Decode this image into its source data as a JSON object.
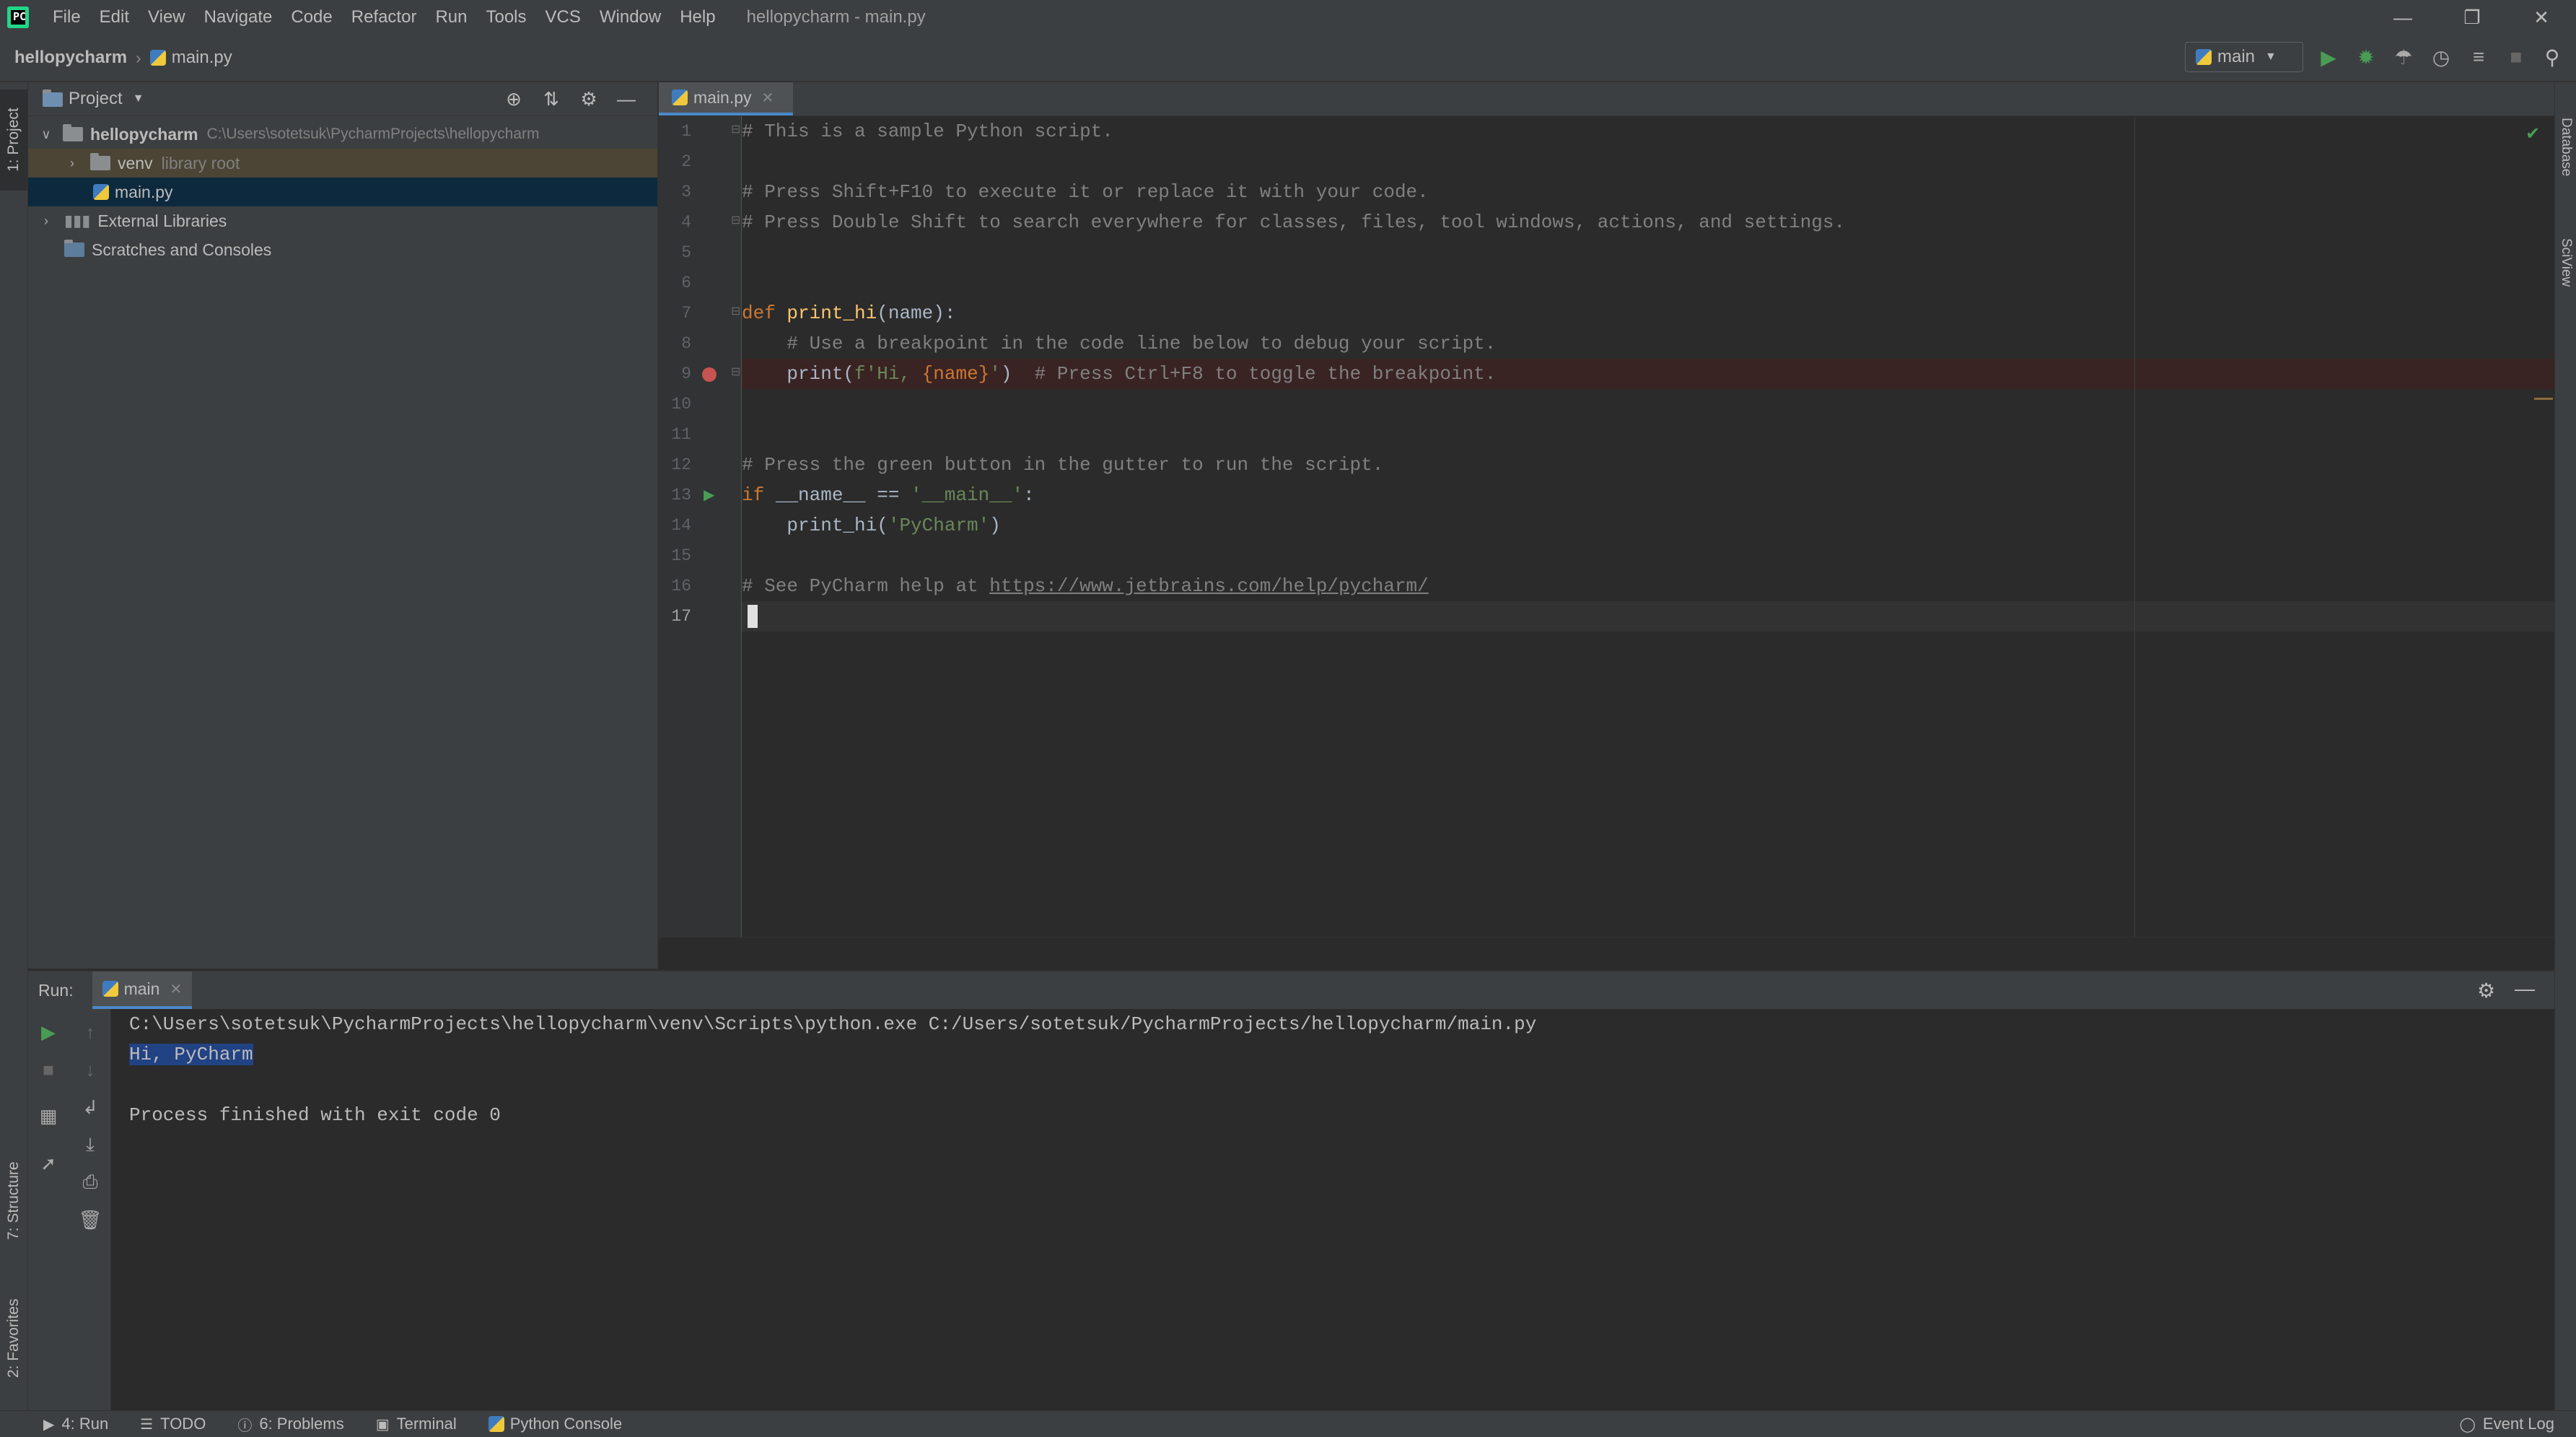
{
  "app": {
    "window_title": "hellopycharm - main.py",
    "menu": [
      "File",
      "Edit",
      "View",
      "Navigate",
      "Code",
      "Refactor",
      "Run",
      "Tools",
      "VCS",
      "Window",
      "Help"
    ]
  },
  "navbar": {
    "project": "hellopycharm",
    "file": "main.py",
    "run_config": "main"
  },
  "project_panel": {
    "title": "Project",
    "tree": [
      {
        "label": "hellopycharm",
        "hint": "C:\\Users\\sotetsuk\\PycharmProjects\\hellopycharm",
        "expanded": true
      },
      {
        "label": "venv",
        "hint": "library root",
        "expanded": false
      },
      {
        "label": "main.py",
        "hint": ""
      },
      {
        "label": "External Libraries",
        "hint": "",
        "expanded": false
      },
      {
        "label": "Scratches and Consoles",
        "hint": ""
      }
    ]
  },
  "editor": {
    "tab": "main.py",
    "line_numbers": [
      "1",
      "2",
      "3",
      "4",
      "5",
      "6",
      "7",
      "8",
      "9",
      "10",
      "11",
      "12",
      "13",
      "14",
      "15",
      "16",
      "17"
    ],
    "lines": {
      "l1": "# This is a sample Python script.",
      "l3": "# Press Shift+F10 to execute it or replace it with your code.",
      "l4": "# Press Double Shift to search everywhere for classes, files, tool windows, actions, and settings.",
      "l7_kw": "def ",
      "l7_fn": "print_hi",
      "l7_rest": "(name):",
      "l8": "    # Use a breakpoint in the code line below to debug your script.",
      "l9_a": "    print(",
      "l9_str1": "f'Hi, ",
      "l9_var": "{name}",
      "l9_str2": "'",
      "l9_b": ")  ",
      "l9_cm": "# Press Ctrl+F8 to toggle the breakpoint.",
      "l12": "# Press the green button in the gutter to run the script.",
      "l13_kw": "if ",
      "l13_a": "__name__ == ",
      "l13_str": "'__main__'",
      "l13_b": ":",
      "l14_a": "    print_hi(",
      "l14_str": "'PyCharm'",
      "l14_b": ")",
      "l16_cm": "# See PyCharm help at ",
      "l16_url": "https://www.jetbrains.com/help/pycharm/"
    }
  },
  "run_panel": {
    "label": "Run:",
    "tab": "main",
    "console": {
      "cmd": "C:\\Users\\sotetsuk\\PycharmProjects\\hellopycharm\\venv\\Scripts\\python.exe C:/Users/sotetsuk/PycharmProjects/hellopycharm/main.py",
      "output": "Hi, PyCharm",
      "exit": "Process finished with exit code 0"
    }
  },
  "side_tabs": {
    "left_top": "1: Project",
    "left_structure": "7: Structure",
    "left_favorites": "2: Favorites",
    "right_database": "Database",
    "right_sciview": "SciView"
  },
  "statusbar": {
    "run": "4: Run",
    "todo": "TODO",
    "problems": "6: Problems",
    "terminal": "Terminal",
    "python_console": "Python Console",
    "event_log": "Event Log"
  },
  "colors": {
    "accent": "#4a88c7",
    "run_green": "#499c54",
    "breakpoint_red": "#c75450",
    "selection": "#214283"
  }
}
